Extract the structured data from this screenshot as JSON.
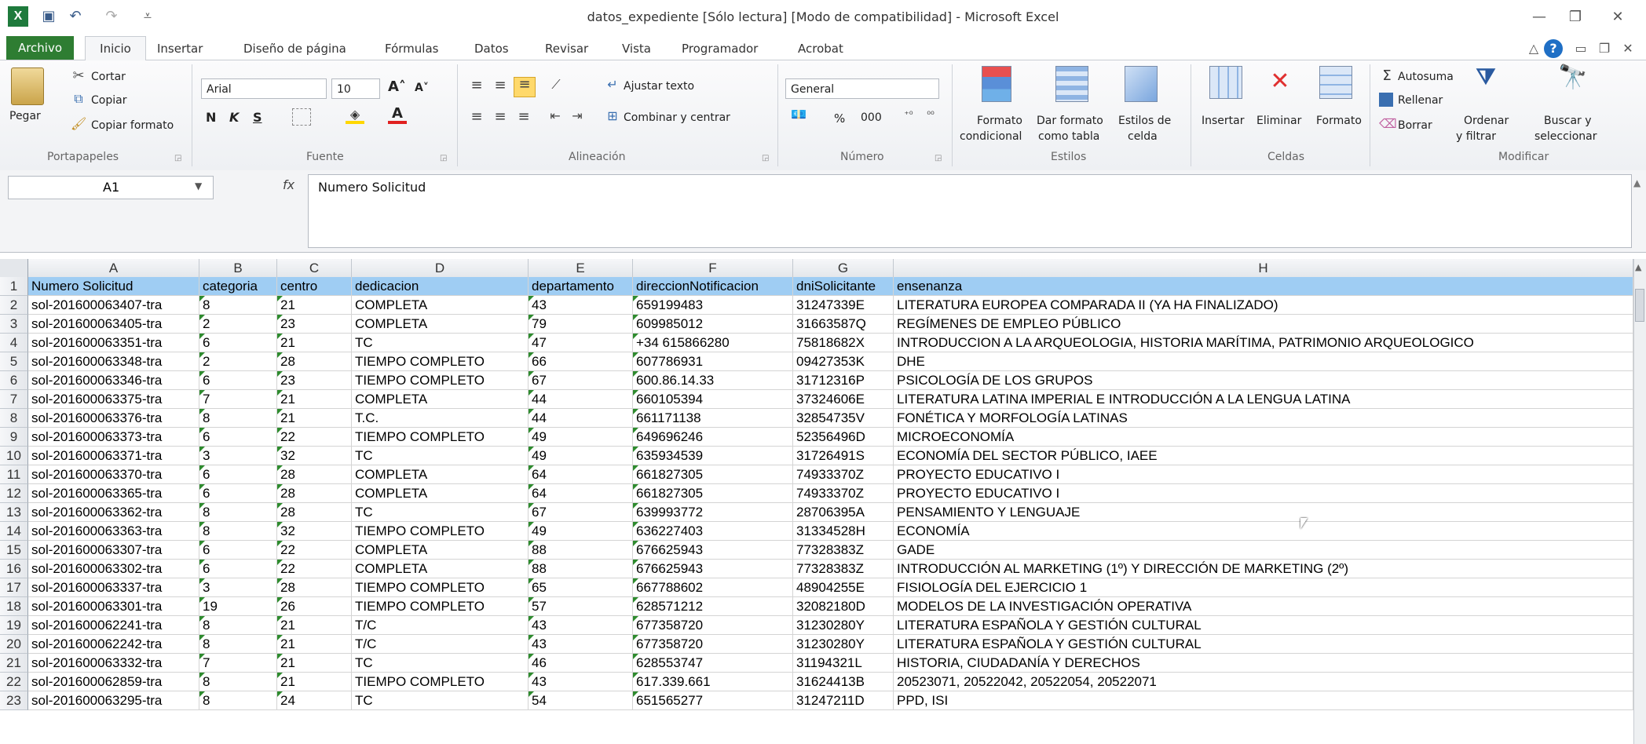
{
  "window": {
    "title": "datos_expediente  [Sólo lectura]  [Modo de compatibilidad]  -  Microsoft Excel",
    "controls": {
      "minimize": "—",
      "restore": "❐",
      "close": "✕"
    }
  },
  "ribbon_tabs": [
    "Archivo",
    "Inicio",
    "Insertar",
    "Diseño de página",
    "Fórmulas",
    "Datos",
    "Revisar",
    "Vista",
    "Programador",
    "Acrobat"
  ],
  "ribbon": {
    "portapapeles": {
      "paste": "Pegar",
      "cut": "Cortar",
      "copy": "Copiar",
      "format_painter": "Copiar formato",
      "group": "Portapapeles"
    },
    "fuente": {
      "font_name": "Arial",
      "font_size": "10",
      "bold": "N",
      "italic": "K",
      "underline": "S",
      "group": "Fuente"
    },
    "alineacion": {
      "wrap": "Ajustar texto",
      "merge": "Combinar y centrar",
      "group": "Alineación"
    },
    "numero": {
      "format": "General",
      "percent": "%",
      "thousands": "000",
      "group": "Número"
    },
    "estilos": {
      "conditional_1": "Formato",
      "conditional_2": "condicional",
      "table_1": "Dar formato",
      "table_2": "como tabla",
      "cell_1": "Estilos de",
      "cell_2": "celda",
      "group": "Estilos"
    },
    "celdas": {
      "insert": "Insertar",
      "delete": "Eliminar",
      "format": "Formato",
      "group": "Celdas"
    },
    "modificar": {
      "autosum": "Autosuma",
      "fill": "Rellenar",
      "clear": "Borrar",
      "sort_1": "Ordenar",
      "sort_2": "y filtrar",
      "find_1": "Buscar y",
      "find_2": "seleccionar",
      "group": "Modificar"
    }
  },
  "formula_bar": {
    "cell_ref": "A1",
    "fx": "fx",
    "content": "Numero Solicitud"
  },
  "columns": [
    "A",
    "B",
    "C",
    "D",
    "E",
    "F",
    "G",
    "H"
  ],
  "headers": [
    "Numero Solicitud",
    "categoria",
    "centro",
    "dedicacion",
    "departamento",
    "direccionNotificacion",
    "dniSolicitante",
    "ensenanza"
  ],
  "rows": [
    [
      "sol-201600063407-tra",
      "8",
      "21",
      "COMPLETA",
      "43",
      "659199483",
      "31247339E",
      "LITERATURA EUROPEA COMPARADA II (YA HA FINALIZADO)"
    ],
    [
      "sol-201600063405-tra",
      "2",
      "23",
      "COMPLETA",
      "79",
      "609985012",
      "31663587Q",
      "REGÍMENES DE EMPLEO PÚBLICO"
    ],
    [
      "sol-201600063351-tra",
      "6",
      "21",
      "TC",
      "47",
      "+34 615866280",
      "75818682X",
      "INTRODUCCION A LA ARQUEOLOGIA, HISTORIA MARÍTIMA, PATRIMONIO ARQUEOLOGICO"
    ],
    [
      "sol-201600063348-tra",
      "2",
      "28",
      "TIEMPO COMPLETO",
      "66",
      "607786931",
      "09427353K",
      "DHE"
    ],
    [
      "sol-201600063346-tra",
      "6",
      "23",
      "TIEMPO COMPLETO",
      "67",
      "600.86.14.33",
      "31712316P",
      "PSICOLOGÍA DE LOS GRUPOS"
    ],
    [
      "sol-201600063375-tra",
      "7",
      "21",
      "COMPLETA",
      "44",
      "660105394",
      "37324606E",
      "LITERATURA LATINA IMPERIAL E INTRODUCCIÓN A LA LENGUA LATINA"
    ],
    [
      "sol-201600063376-tra",
      "8",
      "21",
      "T.C.",
      "44",
      "661171138",
      "32854735V",
      "FONÉTICA Y MORFOLOGÍA LATINAS"
    ],
    [
      "sol-201600063373-tra",
      "6",
      "22",
      "TIEMPO COMPLETO",
      "49",
      "649696246",
      "52356496D",
      "MICROECONOMÍA"
    ],
    [
      "sol-201600063371-tra",
      "3",
      "32",
      "TC",
      "49",
      "635934539",
      "31726491S",
      "ECONOMÍA DEL SECTOR PÚBLICO, IAEE"
    ],
    [
      "sol-201600063370-tra",
      "6",
      "28",
      "COMPLETA",
      "64",
      "661827305",
      "74933370Z",
      "PROYECTO EDUCATIVO I"
    ],
    [
      "sol-201600063365-tra",
      "6",
      "28",
      "COMPLETA",
      "64",
      "661827305",
      "74933370Z",
      "PROYECTO EDUCATIVO I"
    ],
    [
      "sol-201600063362-tra",
      "8",
      "28",
      "TC",
      "67",
      "639993772",
      "28706395A",
      "PENSAMIENTO Y LENGUAJE"
    ],
    [
      "sol-201600063363-tra",
      "8",
      "32",
      "TIEMPO COMPLETO",
      "49",
      "636227403",
      "31334528H",
      "ECONOMÍA"
    ],
    [
      "sol-201600063307-tra",
      "6",
      "22",
      "COMPLETA",
      "88",
      "676625943",
      "77328383Z",
      "GADE"
    ],
    [
      "sol-201600063302-tra",
      "6",
      "22",
      "COMPLETA",
      "88",
      "676625943",
      "77328383Z",
      "INTRODUCCIÓN AL MARKETING (1º) Y DIRECCIÓN DE MARKETING (2º)"
    ],
    [
      "sol-201600063337-tra",
      "3",
      "28",
      "TIEMPO COMPLETO",
      "65",
      "667788602",
      "48904255E",
      "FISIOLOGÍA DEL EJERCICIO 1"
    ],
    [
      "sol-201600063301-tra",
      "19",
      "26",
      "TIEMPO COMPLETO",
      "57",
      "628571212",
      "32082180D",
      "MODELOS DE LA INVESTIGACIÓN OPERATIVA"
    ],
    [
      "sol-201600062241-tra",
      "8",
      "21",
      "T/C",
      "43",
      "677358720",
      "31230280Y",
      "LITERATURA ESPAÑOLA Y GESTIÓN CULTURAL"
    ],
    [
      "sol-201600062242-tra",
      "8",
      "21",
      "T/C",
      "43",
      "677358720",
      "31230280Y",
      "LITERATURA ESPAÑOLA Y GESTIÓN CULTURAL"
    ],
    [
      "sol-201600063332-tra",
      "7",
      "21",
      "TC",
      "46",
      "628553747",
      "31194321L",
      "HISTORIA, CIUDADANÍA Y DERECHOS"
    ],
    [
      "sol-201600062859-tra",
      "8",
      "21",
      "TIEMPO COMPLETO",
      "43",
      "617.339.661",
      "31624413B",
      "20523071, 20522042, 20522054, 20522071"
    ],
    [
      "sol-201600063295-tra",
      "8",
      "24",
      "TC",
      "54",
      "651565277",
      "31247211D",
      "PPD, ISI"
    ]
  ],
  "colors": {
    "archivo_tab": "#2e7d32",
    "header_row": "#9fcdf3",
    "error_triangle": "#2e8b2e"
  }
}
